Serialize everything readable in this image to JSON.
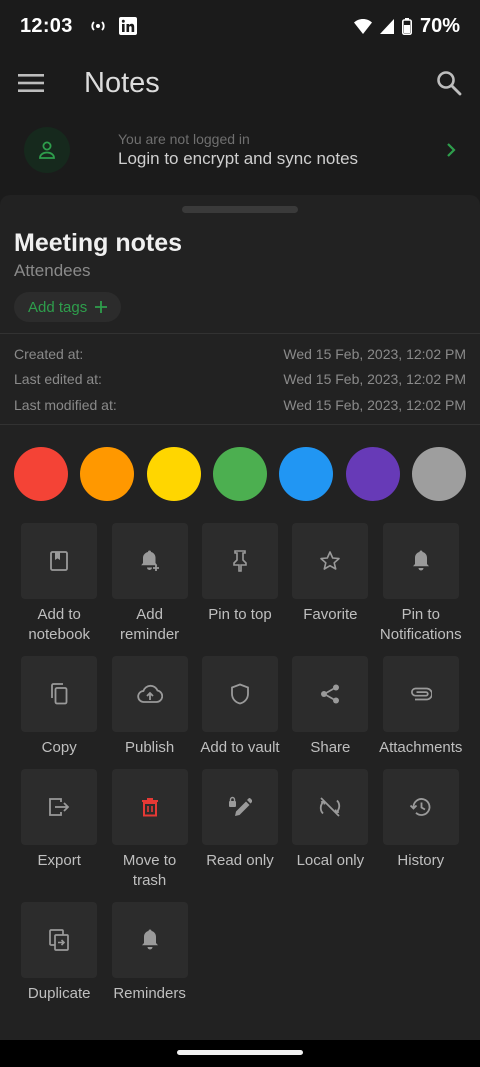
{
  "status": {
    "time": "12:03",
    "battery": "70%"
  },
  "app_bar": {
    "title": "Notes"
  },
  "login": {
    "subtitle": "You are not logged in",
    "title": "Login to encrypt and sync notes"
  },
  "note": {
    "title": "Meeting notes",
    "subtitle": "Attendees",
    "tags_label": "Add tags"
  },
  "meta": {
    "created_label": "Created at:",
    "created_value": "Wed 15 Feb, 2023, 12:02 PM",
    "edited_label": "Last edited at:",
    "edited_value": "Wed 15 Feb, 2023, 12:02 PM",
    "modified_label": "Last modified at:",
    "modified_value": "Wed 15 Feb, 2023, 12:02 PM"
  },
  "colors": [
    "#f44336",
    "#ff9800",
    "#ffd600",
    "#4caf50",
    "#2196f3",
    "#673ab7",
    "#9e9e9e"
  ],
  "actions": [
    {
      "label": "Add to\nnotebook",
      "icon": "notebook-icon"
    },
    {
      "label": "Add\nreminder",
      "icon": "bell-plus-icon"
    },
    {
      "label": "Pin to top",
      "icon": "pin-icon"
    },
    {
      "label": "Favorite",
      "icon": "star-icon"
    },
    {
      "label": "Pin to\nNotifications",
      "icon": "bell-icon"
    },
    {
      "label": "Copy",
      "icon": "copy-icon"
    },
    {
      "label": "Publish",
      "icon": "cloud-upload-icon"
    },
    {
      "label": "Add to vault",
      "icon": "shield-icon"
    },
    {
      "label": "Share",
      "icon": "share-icon"
    },
    {
      "label": "Attachments",
      "icon": "paperclip-icon"
    },
    {
      "label": "Export",
      "icon": "export-icon"
    },
    {
      "label": "Move to\ntrash",
      "icon": "trash-icon"
    },
    {
      "label": "Read only",
      "icon": "pencil-lock-icon"
    },
    {
      "label": "Local only",
      "icon": "sync-off-icon"
    },
    {
      "label": "History",
      "icon": "history-icon"
    },
    {
      "label": "Duplicate",
      "icon": "duplicate-icon"
    },
    {
      "label": "Reminders",
      "icon": "bell-icon"
    }
  ],
  "accent_color": "#2e9e4c",
  "trash_color": "#e53935"
}
